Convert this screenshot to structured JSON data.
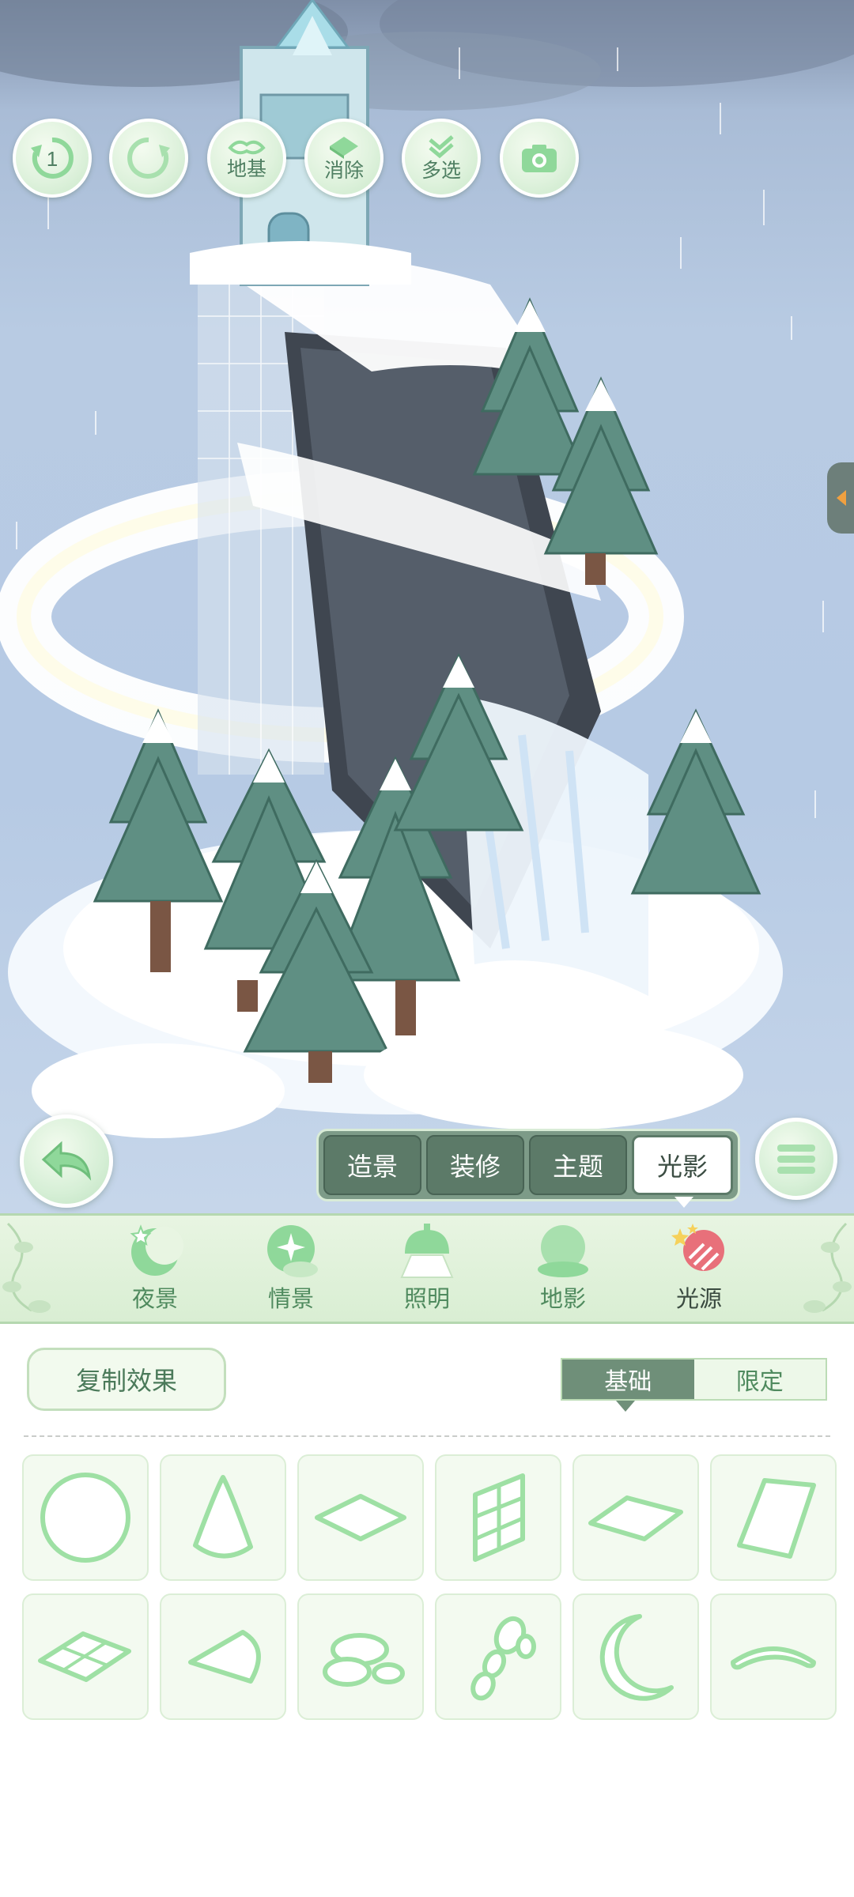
{
  "toolbar": {
    "undo_count": "1",
    "foundation_label": "地基",
    "erase_label": "消除",
    "multiselect_label": "多选"
  },
  "mode_tabs": [
    {
      "label": "造景",
      "active": false
    },
    {
      "label": "装修",
      "active": false
    },
    {
      "label": "主题",
      "active": false
    },
    {
      "label": "光影",
      "active": true
    }
  ],
  "categories": [
    {
      "label": "夜景",
      "icon": "moon-night-icon",
      "active": false
    },
    {
      "label": "情景",
      "icon": "sparkle-scene-icon",
      "active": false
    },
    {
      "label": "照明",
      "icon": "lamp-icon",
      "active": false
    },
    {
      "label": "地影",
      "icon": "ground-shadow-icon",
      "active": false
    },
    {
      "label": "光源",
      "icon": "light-source-icon",
      "active": true
    }
  ],
  "panel": {
    "copy_effect_label": "复制效果",
    "segments": [
      {
        "label": "基础",
        "active": true
      },
      {
        "label": "限定",
        "active": false
      }
    ],
    "shapes": [
      "circle-shape-icon",
      "cone-shape-icon",
      "diamond-shape-icon",
      "window-shape-icon",
      "flat-diamond-shape-icon",
      "trapezoid-shape-icon",
      "grid-diamond-shape-icon",
      "kite-shape-icon",
      "cloud-shape-icon",
      "beads-shape-icon",
      "crescent-shape-icon",
      "arc-shape-icon"
    ]
  },
  "colors": {
    "accent_green": "#6f8f79",
    "tab_dark": "#5c7a68",
    "light_green": "#e8f5e2",
    "icon_green": "#8fd89a",
    "active_light_source": "#e8707a"
  }
}
